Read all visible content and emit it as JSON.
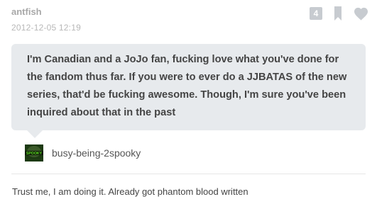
{
  "post": {
    "username": "antfish",
    "timestamp": "2012-12-05 12:19",
    "note_count": "4"
  },
  "question": {
    "text": "I'm Canadian and a JoJo fan, fucking love what you've done for the fandom thus far. If you were to ever do a JJBATAS of the new series, that'd be fucking awesome. Though, I'm sure you've been inquired about that in the past",
    "asker": "busy-being-2spooky",
    "avatar_text": "SPOOKY"
  },
  "answer": {
    "text": "Trust me, I am doing it. Already got phantom blood written"
  },
  "icons": {
    "reblog": "reblog-icon",
    "like": "heart-icon"
  },
  "colors": {
    "question_bg": "#e7eaed",
    "note_badge": "#c7cbd0",
    "icon_gray": "#c7cbd0",
    "avatar_bg": "#1d3a13",
    "avatar_text": "#58e01c"
  }
}
